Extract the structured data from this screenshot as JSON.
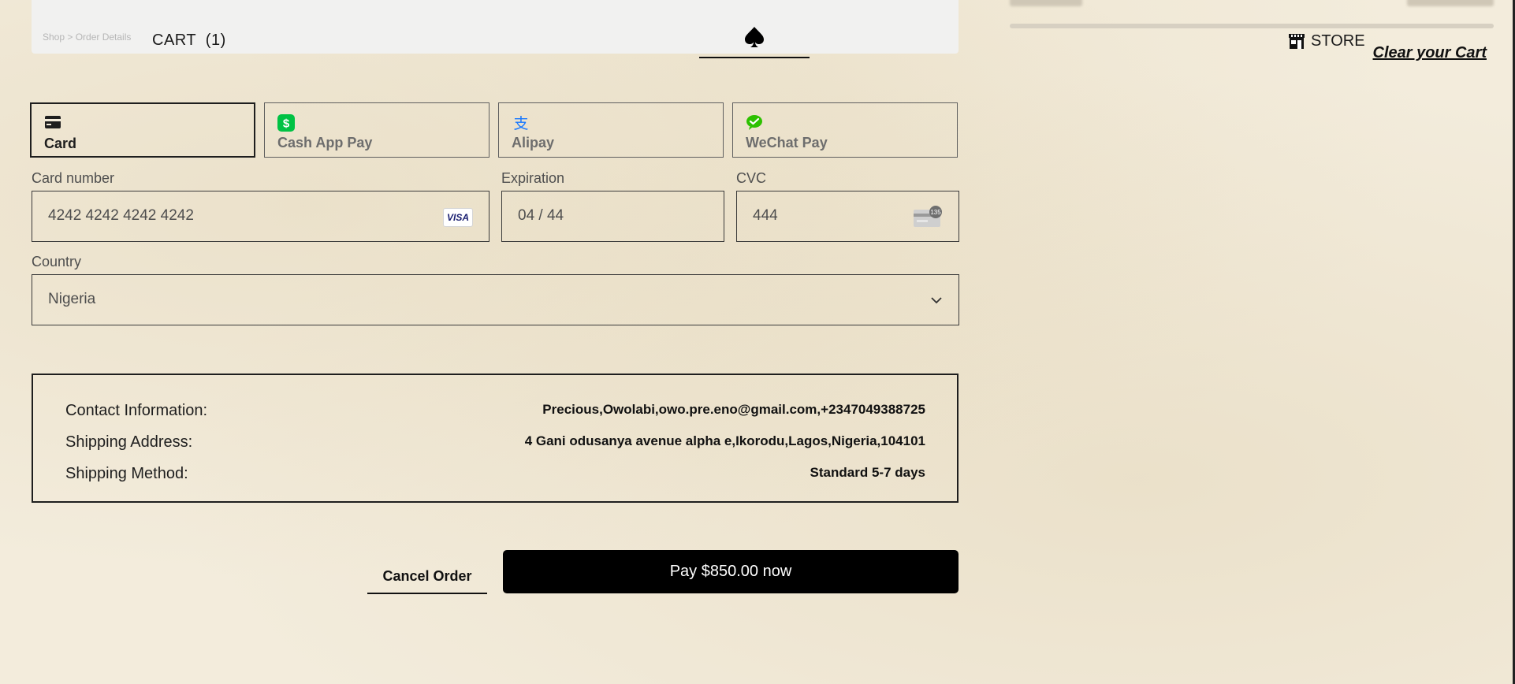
{
  "header": {
    "breadcrumb": "Shop  >  Order Details",
    "cart_label": "CART",
    "cart_count": "(1)",
    "logo_icon": "spade-icon",
    "store_label": "STORE",
    "store_icon": "storefront-icon",
    "clear_cart_label": "Clear your Cart"
  },
  "payment_tabs": [
    {
      "label": "Card",
      "icon": "card-icon",
      "selected": true
    },
    {
      "label": "Cash App Pay",
      "icon": "cash-app-icon",
      "selected": false
    },
    {
      "label": "Alipay",
      "icon": "alipay-icon",
      "selected": false
    },
    {
      "label": "WeChat Pay",
      "icon": "wechat-icon",
      "selected": false
    }
  ],
  "form": {
    "card_number_label": "Card number",
    "card_number_value": "4242 4242 4242 4242",
    "card_brand": "VISA",
    "expiration_label": "Expiration",
    "expiration_value": "04 / 44",
    "cvc_label": "CVC",
    "cvc_value": "444",
    "cvc_hint": "135",
    "country_label": "Country",
    "country_value": "Nigeria"
  },
  "summary": {
    "contact_label": "Contact Information:",
    "contact_value": "Precious,Owolabi,owo.pre.eno@gmail.com,+2347049388725",
    "shipping_address_label": "Shipping Address:",
    "shipping_address_value": "4 Gani odusanya avenue alpha e,Ikorodu,Lagos,Nigeria,104101",
    "shipping_method_label": "Shipping Method:",
    "shipping_method_value": "Standard 5-7 days"
  },
  "actions": {
    "cancel_label": "Cancel Order",
    "pay_label": "Pay $850.00 now"
  },
  "colors": {
    "page_bg": "#f3ecdc",
    "pay_button_bg": "#000000",
    "cash_app_green": "#00c244",
    "alipay_blue": "#1677ff",
    "wechat_green": "#2dc100"
  }
}
